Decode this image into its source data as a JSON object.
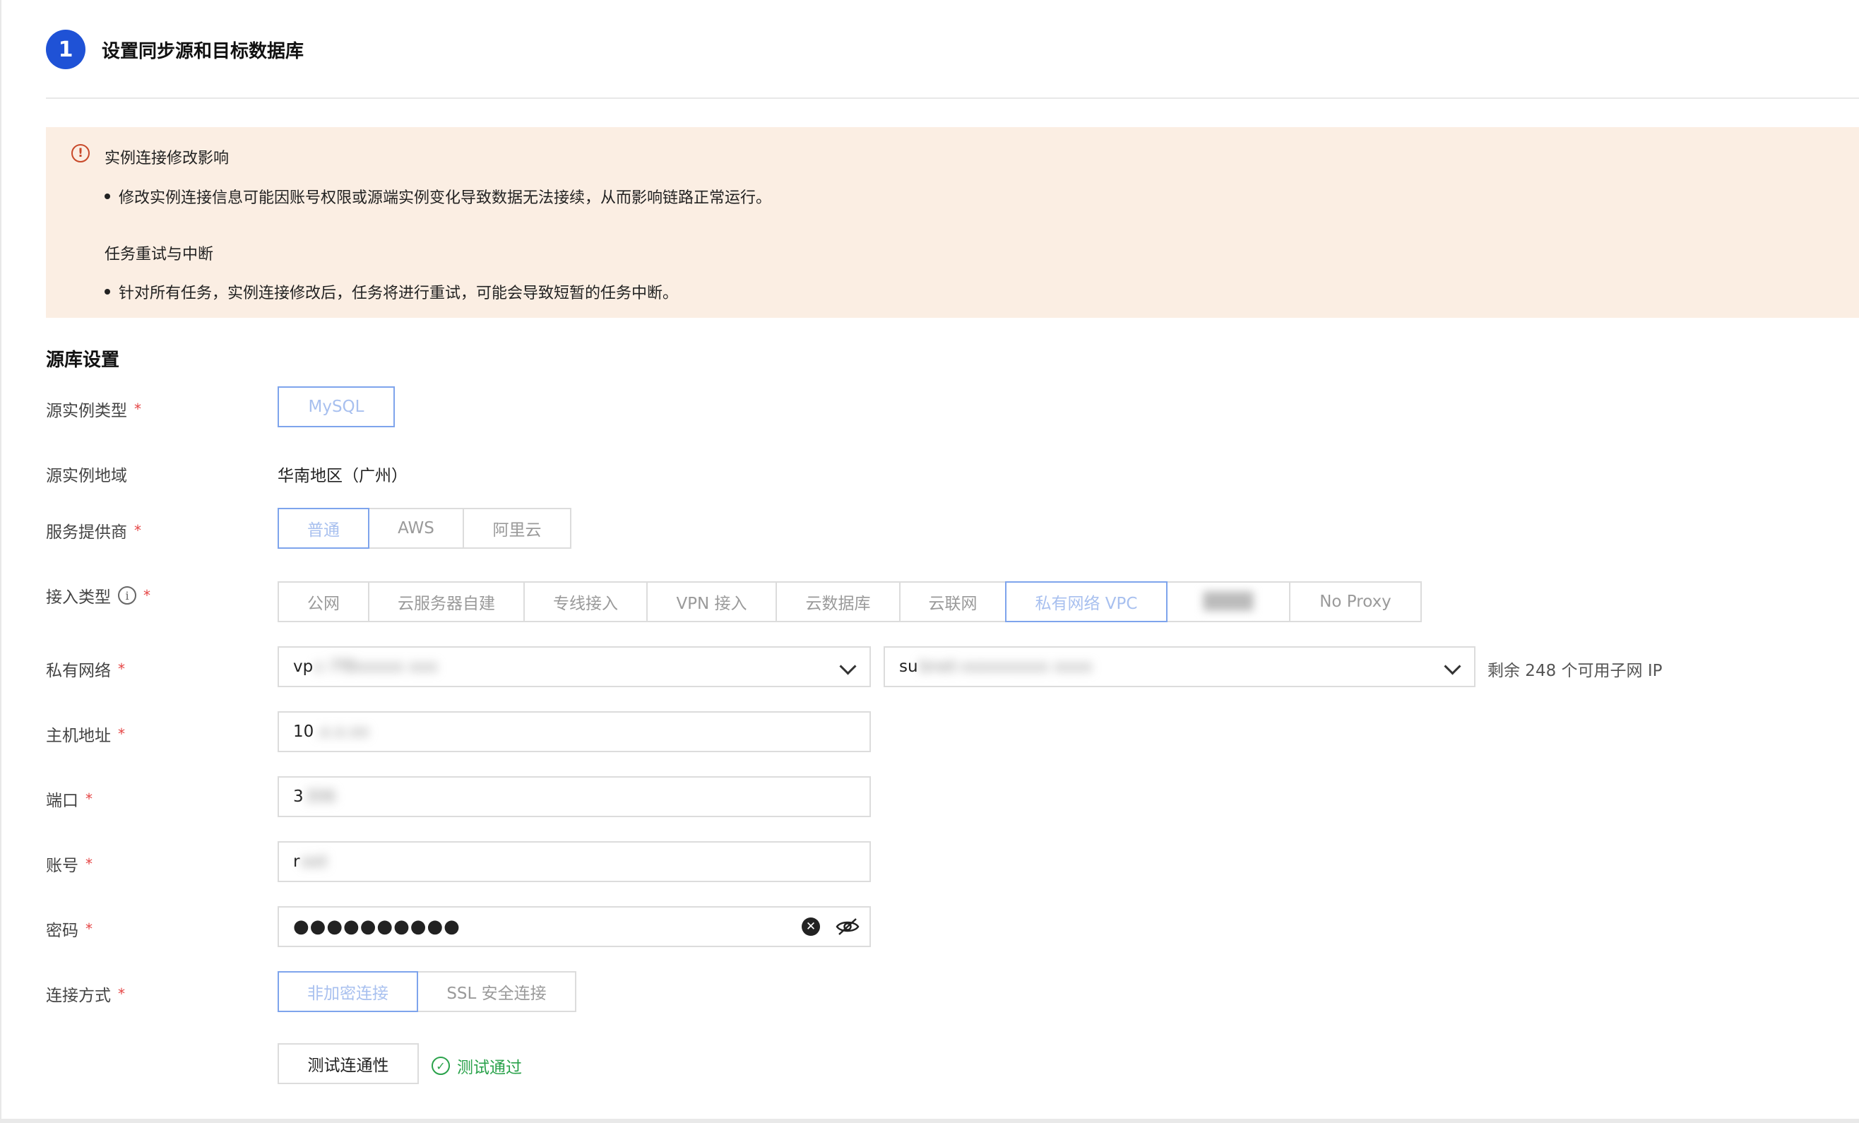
{
  "step": {
    "number": "1",
    "title": "设置同步源和目标数据库"
  },
  "notice": {
    "title1": "实例连接修改影响",
    "item1": "修改实例连接信息可能因账号权限或源端实例变化导致数据无法接续，从而影响链路正常运行。",
    "title2": "任务重试与中断",
    "item2": "针对所有任务，实例连接修改后，任务将进行重试，可能会导致短暂的任务中断。"
  },
  "section_title": "源库设置",
  "fields": {
    "instance_type": {
      "label": "源实例类型",
      "options": [
        "MySQL"
      ],
      "selected": "MySQL"
    },
    "region": {
      "label": "源实例地域",
      "value": "华南地区（广州）"
    },
    "provider": {
      "label": "服务提供商",
      "options": [
        "普通",
        "AWS",
        "阿里云"
      ],
      "selected": "普通"
    },
    "access_type": {
      "label": "接入类型",
      "options": [
        "公网",
        "云服务器自建",
        "专线接入",
        "VPN 接入",
        "云数据库",
        "云联网",
        "私有网络 VPC",
        "████",
        "No Proxy"
      ],
      "selected": "私有网络 VPC"
    },
    "vpc": {
      "label": "私有网络",
      "vpc_prefix": "vp",
      "vpc_hidden": "c-7f8xxxxx xxx",
      "subnet_prefix": "su",
      "subnet_hidden": "bnet-xxxxxxxxx xxxx",
      "ip_note": "剩余 248 个可用子网 IP"
    },
    "host": {
      "label": "主机地址",
      "prefix": "10",
      "hidden": ".x.x.xx"
    },
    "port": {
      "label": "端口",
      "prefix": "3",
      "hidden": "306"
    },
    "account": {
      "label": "账号",
      "prefix": "r",
      "hidden": "oot"
    },
    "password": {
      "label": "密码",
      "value": "●●●●●●●●●●"
    },
    "conn_mode": {
      "label": "连接方式",
      "options": [
        "非加密连接",
        "SSL 安全连接"
      ],
      "selected": "非加密连接"
    }
  },
  "test_button": "测试连通性",
  "test_result": "测试通过",
  "required_mark": "*"
}
